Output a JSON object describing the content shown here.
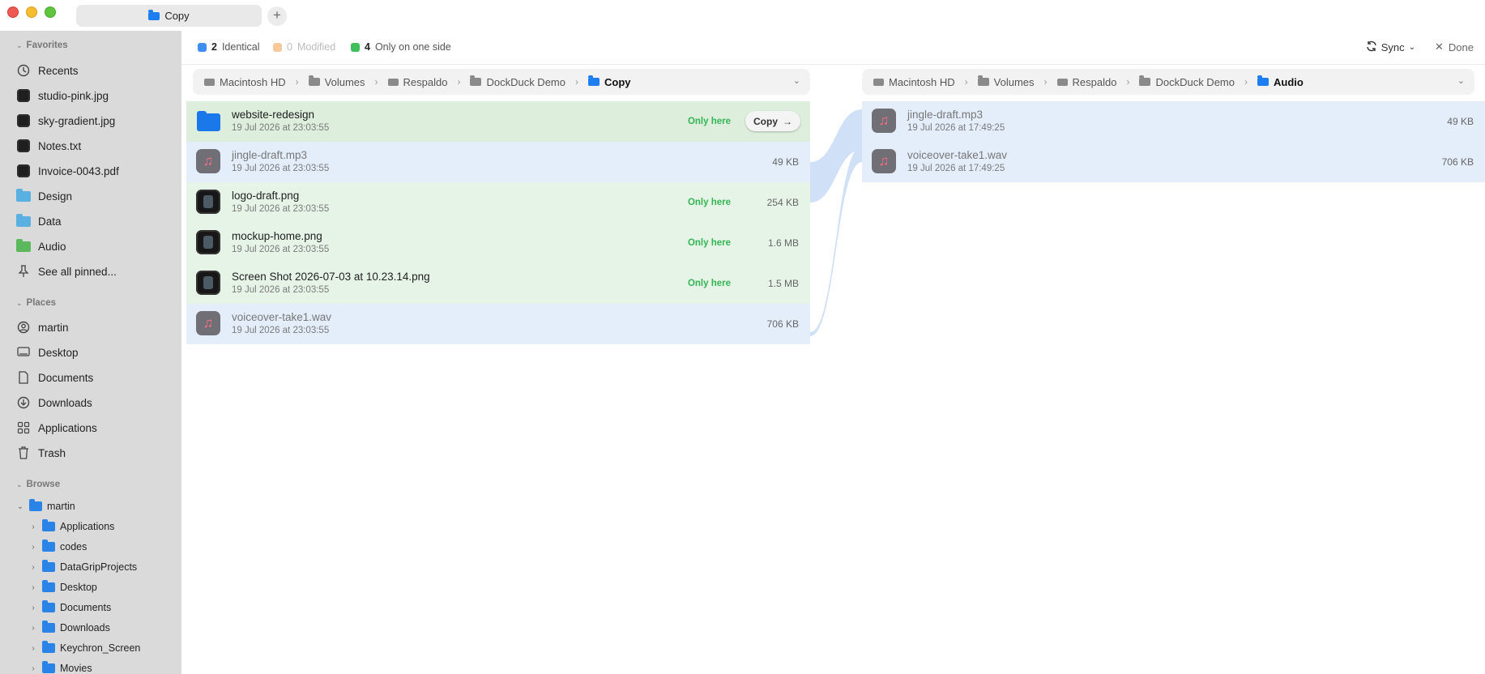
{
  "window": {
    "tab_title": "Copy",
    "new_tab_label": "+"
  },
  "sidebar": {
    "favorites_label": "Favorites",
    "favorites": [
      {
        "label": "Recents",
        "icon": "clock-icon"
      },
      {
        "label": "studio-pink.jpg",
        "icon": "image-thumb-icon"
      },
      {
        "label": "sky-gradient.jpg",
        "icon": "image-thumb-icon"
      },
      {
        "label": "Notes.txt",
        "icon": "text-file-icon"
      },
      {
        "label": "Invoice-0043.pdf",
        "icon": "pdf-thumb-icon"
      },
      {
        "label": "Design",
        "icon": "folder-icon",
        "color": "#5ab0e0"
      },
      {
        "label": "Data",
        "icon": "folder-icon",
        "color": "#5ab0e0"
      },
      {
        "label": "Audio",
        "icon": "folder-icon",
        "color": "#5cb85c"
      },
      {
        "label": "See all pinned...",
        "icon": "pin-icon"
      }
    ],
    "places_label": "Places",
    "places": [
      {
        "label": "martin",
        "icon": "user-icon"
      },
      {
        "label": "Desktop",
        "icon": "desktop-icon"
      },
      {
        "label": "Documents",
        "icon": "document-icon"
      },
      {
        "label": "Downloads",
        "icon": "download-icon"
      },
      {
        "label": "Applications",
        "icon": "apps-grid-icon"
      },
      {
        "label": "Trash",
        "icon": "trash-icon"
      }
    ],
    "browse_label": "Browse",
    "browse_root": "martin",
    "browse_children": [
      "Applications",
      "codes",
      "DataGripProjects",
      "Desktop",
      "Documents",
      "Downloads",
      "Keychron_Screen",
      "Movies"
    ]
  },
  "summary": {
    "identical_count": "2",
    "identical_label": "Identical",
    "modified_count": "0",
    "modified_label": "Modified",
    "one_side_count": "4",
    "one_side_label": "Only on one side",
    "colors": {
      "identical": "#3d8ef0",
      "modified": "#f7c89a",
      "one_side": "#3fbf5c"
    },
    "sync_label": "Sync",
    "done_label": "Done"
  },
  "left_path": [
    "Macintosh HD",
    "Volumes",
    "Respaldo",
    "DockDuck Demo",
    "Copy"
  ],
  "right_path": [
    "Macintosh HD",
    "Volumes",
    "Respaldo",
    "DockDuck Demo",
    "Audio"
  ],
  "left_files": [
    {
      "name": "website-redesign",
      "date": "19 Jul 2026 at 23:03:55",
      "size": "",
      "status": "Only here",
      "action": "Copy",
      "type": "folder"
    },
    {
      "name": "jingle-draft.mp3",
      "date": "19 Jul 2026 at 23:03:55",
      "size": "49 KB",
      "status": "",
      "type": "audio"
    },
    {
      "name": "logo-draft.png",
      "date": "19 Jul 2026 at 23:03:55",
      "size": "254 KB",
      "status": "Only here",
      "type": "image"
    },
    {
      "name": "mockup-home.png",
      "date": "19 Jul 2026 at 23:03:55",
      "size": "1.6 MB",
      "status": "Only here",
      "type": "image"
    },
    {
      "name": "Screen Shot 2026-07-03 at 10.23.14.png",
      "date": "19 Jul 2026 at 23:03:55",
      "size": "1.5 MB",
      "status": "Only here",
      "type": "image"
    },
    {
      "name": "voiceover-take1.wav",
      "date": "19 Jul 2026 at 23:03:55",
      "size": "706 KB",
      "status": "",
      "type": "audio"
    }
  ],
  "right_files": [
    {
      "name": "jingle-draft.mp3",
      "date": "19 Jul 2026 at 17:49:25",
      "size": "49 KB",
      "type": "audio"
    },
    {
      "name": "voiceover-take1.wav",
      "date": "19 Jul 2026 at 17:49:25",
      "size": "706 KB",
      "type": "audio"
    }
  ]
}
